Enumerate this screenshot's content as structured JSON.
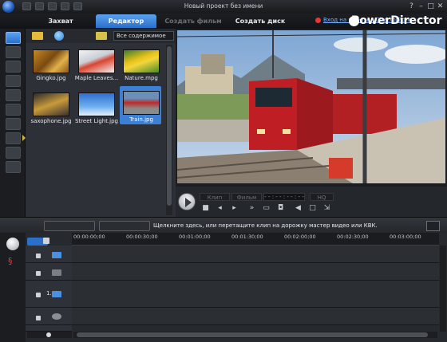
{
  "window": {
    "title": "Новый проект без имени"
  },
  "tabs": [
    {
      "label": "Захват",
      "state": "normal"
    },
    {
      "label": "Редактор",
      "state": "active"
    },
    {
      "label": "Создать фильм",
      "state": "disabled"
    },
    {
      "label": "Создать диск",
      "state": "normal"
    }
  ],
  "header": {
    "directorzone_link": "Вход на веб-узел DirectorZone",
    "brand": "PowerDirector"
  },
  "library": {
    "filter_value": "Все содержимое",
    "items": [
      {
        "label": "Gingko.jpg",
        "icon": "gingko-thumbnail"
      },
      {
        "label": "Maple Leaves...",
        "icon": "maple-leaves-thumbnail"
      },
      {
        "label": "Nature.mpg",
        "icon": "nature-thumbnail"
      },
      {
        "label": "saxophone.jpg",
        "icon": "saxophone-thumbnail"
      },
      {
        "label": "Street Light.jpg",
        "icon": "street-light-thumbnail"
      },
      {
        "label": "Train.jpg",
        "icon": "train-thumbnail",
        "selected": true
      }
    ]
  },
  "preview": {
    "mode_clip": "Клип",
    "mode_movie": "Фильм",
    "timecode": "- - : - - : - - : - -",
    "quality": "HQ"
  },
  "timeline": {
    "hint": "Щелкните здесь, или перетащите клип на дорожку мастер видео или КВК.",
    "ruler": [
      "00:00:00;00",
      "00:00:30;00",
      "00:01:00;00",
      "00:01:30;00",
      "00:02:00;00",
      "00:02:30;00",
      "00:03:00;00"
    ],
    "track1_label": "1."
  },
  "colors": {
    "accent": "#3c7fd6",
    "background": "#23262b",
    "link": "#7db6ff"
  }
}
